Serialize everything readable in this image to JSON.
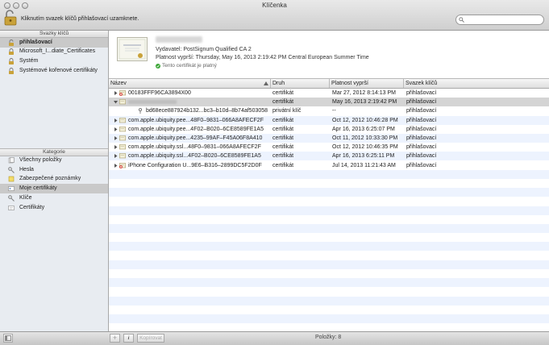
{
  "window": {
    "title": "Klíčenka"
  },
  "toolbar": {
    "lock_hint": "Kliknutím svazek klíčů přihlašovací uzamknete.",
    "search": {
      "value": "",
      "placeholder": ""
    }
  },
  "sidebar": {
    "keychains_header": "Svazky klíčů",
    "keychains": [
      {
        "label": "přihlašovací",
        "icon": "open-lock-icon",
        "selected": true
      },
      {
        "label": "Microsoft_I...diate_Certificates",
        "icon": "lock-icon"
      },
      {
        "label": "Systém",
        "icon": "lock-icon"
      },
      {
        "label": "Systémové kořenové certifikáty",
        "icon": "lock-icon"
      }
    ],
    "categories_header": "Kategorie",
    "categories": [
      {
        "label": "Všechny položky",
        "icon": "all-items-icon"
      },
      {
        "label": "Hesla",
        "icon": "key-icon"
      },
      {
        "label": "Zabezpečené poznámky",
        "icon": "note-icon"
      },
      {
        "label": "Moje certifikáty",
        "icon": "my-certificate-icon",
        "selected": true
      },
      {
        "label": "Klíče",
        "icon": "key-icon"
      },
      {
        "label": "Certifikáty",
        "icon": "certificate-icon"
      }
    ]
  },
  "detail": {
    "issuer": "Vydavatel: PostSignum Qualified CA 2",
    "expires": "Platnost vyprší: Thursday, May 16, 2013 2:19:42 PM Central European Summer Time",
    "validity": "Tento certifikát je platný"
  },
  "table": {
    "columns": [
      "Název",
      "Druh",
      "Platnost vyprší",
      "Svazek klíčů"
    ],
    "rows": [
      {
        "name": "00183FFF96CA3894X00",
        "kind": "certifikát",
        "expires": "Mar 27, 2012 8:14:13 PM",
        "keychain": "přihlašovací",
        "icon": "certificate-error-icon",
        "indent": 0,
        "disclosure": "collapsed"
      },
      {
        "name": "",
        "kind": "certifikát",
        "expires": "May 16, 2013 2:19:42 PM",
        "keychain": "přihlašovací",
        "icon": "certificate-icon",
        "indent": 0,
        "disclosure": "expanded",
        "selected": true
      },
      {
        "name": "bd68ece887924b132...bc3–b10d–8b74af503058",
        "kind": "privátní klíč",
        "expires": "--",
        "keychain": "přihlašovací",
        "icon": "private-key-icon",
        "indent": 1,
        "disclosure": "none"
      },
      {
        "name": "com.apple.ubiquity.pee...48F0–9831–066A8AFECF2F",
        "kind": "certifikát",
        "expires": "Oct 12, 2012 10:46:28 PM",
        "keychain": "přihlašovací",
        "icon": "certificate-icon",
        "indent": 0,
        "disclosure": "collapsed"
      },
      {
        "name": "com.apple.ubiquity.pee...4F02–B020–6CE8589FE1A5",
        "kind": "certifikát",
        "expires": "Apr 16, 2013 6:25:07 PM",
        "keychain": "přihlašovací",
        "icon": "certificate-icon",
        "indent": 0,
        "disclosure": "collapsed"
      },
      {
        "name": "com.apple.ubiquity.pee...4235–99AF–F45A06F8A410",
        "kind": "certifikát",
        "expires": "Oct 11, 2012 10:33:30 PM",
        "keychain": "přihlašovací",
        "icon": "certificate-icon",
        "indent": 0,
        "disclosure": "collapsed"
      },
      {
        "name": "com.apple.ubiquity.ssl...48F0–9831–066A8AFECF2F",
        "kind": "certifikát",
        "expires": "Oct 12, 2012 10:46:35 PM",
        "keychain": "přihlašovací",
        "icon": "certificate-icon",
        "indent": 0,
        "disclosure": "collapsed"
      },
      {
        "name": "com.apple.ubiquity.ssl...4F02–B020–6CE8589FE1A5",
        "kind": "certifikát",
        "expires": "Apr 16, 2013 6:25:11 PM",
        "keychain": "přihlašovací",
        "icon": "certificate-icon",
        "indent": 0,
        "disclosure": "collapsed"
      },
      {
        "name": "iPhone Configuration U...9E6–B316–2899DC5F2D0F",
        "kind": "certifikát",
        "expires": "Jul 14, 2013 11:21:43 AM",
        "keychain": "přihlašovací",
        "icon": "certificate-error-icon",
        "indent": 0,
        "disclosure": "collapsed"
      }
    ]
  },
  "bottom": {
    "copy_label": "Kopírovat",
    "status": "Položky: 8"
  },
  "colors": {
    "selection": "#d4d4d4",
    "sidebar_bg": "#e8ecf1",
    "stripe": "#edf3fe",
    "valid_green": "#3aa535",
    "error_red": "#d6352b"
  }
}
